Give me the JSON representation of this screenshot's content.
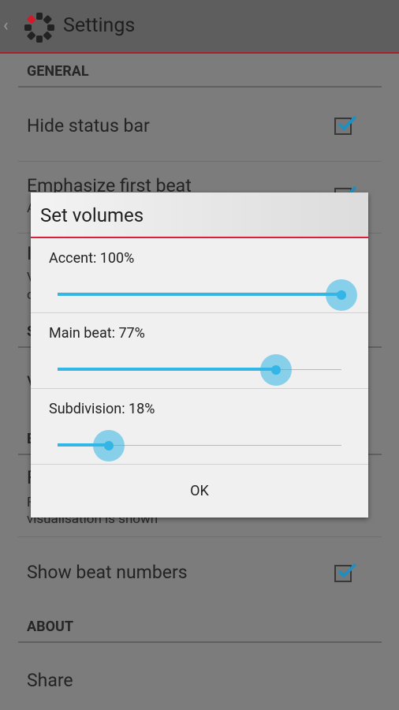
{
  "action_bar": {
    "title": "Settings",
    "back_icon": "chevron-left-icon",
    "app_icon": "metronome-ring-icon"
  },
  "settings": {
    "general_header": "GENERAL",
    "hide_status_bar": {
      "title": "Hide status bar",
      "checked": true
    },
    "emphasize_first_beat": {
      "title": "Emphasize first beat",
      "summary_fragment": "A",
      "checked": true
    },
    "partial_item_3": {
      "title_fragment": "I",
      "summary_line1": "V",
      "summary_line2": "c"
    },
    "partial_section_2": {
      "header_fragment": "S"
    },
    "partial_item_4": {
      "title_fragment": "V"
    },
    "partial_section_3": {
      "header_fragment": "B"
    },
    "partial_item_5": {
      "title_fragment": "F",
      "summary_line1": "F",
      "summary_line2": "visualisation is shown"
    },
    "show_beat_numbers": {
      "title": "Show beat numbers",
      "checked": true
    },
    "about_header": "ABOUT",
    "share": {
      "title": "Share"
    }
  },
  "dialog": {
    "title": "Set volumes",
    "sliders": [
      {
        "label": "Accent: 100%",
        "value": 1.0
      },
      {
        "label": "Main beat: 77%",
        "value": 0.77
      },
      {
        "label": "Subdivision: 18%",
        "value": 0.18
      }
    ],
    "ok_label": "OK"
  },
  "colors": {
    "accent": "#33b5e5",
    "divider_red": "#d8213a"
  }
}
